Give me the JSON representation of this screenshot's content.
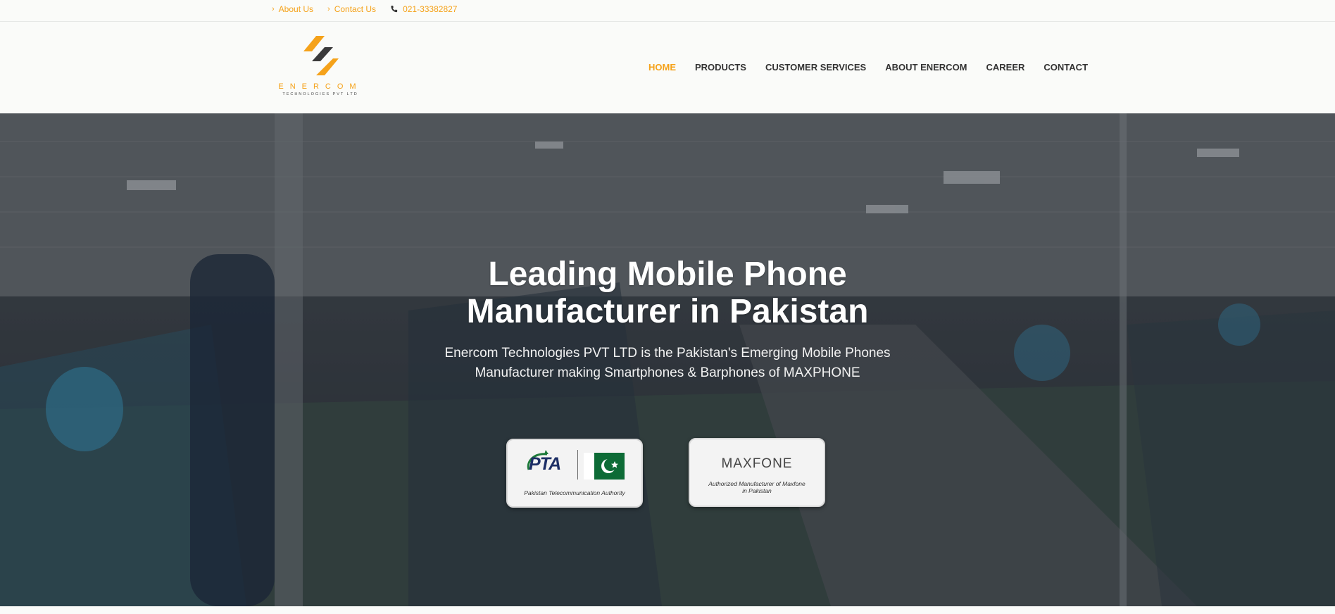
{
  "topbar": {
    "about_label": "About Us",
    "contact_label": "Contact Us",
    "phone": "021-33382827"
  },
  "brand": {
    "name": "ENERCOM",
    "tagline": "TECHNOLOGIES PVT LTD"
  },
  "nav": {
    "items": [
      {
        "label": "HOME",
        "active": true
      },
      {
        "label": "PRODUCTS"
      },
      {
        "label": "CUSTOMER SERVICES"
      },
      {
        "label": "ABOUT ENERCOM"
      },
      {
        "label": "CAREER"
      },
      {
        "label": "CONTACT"
      }
    ]
  },
  "hero": {
    "title_line1": "Leading Mobile Phone",
    "title_line2": "Manufacturer in Pakistan",
    "subtitle_line1": "Enercom Technologies PVT LTD is the Pakistan's Emerging Mobile Phones",
    "subtitle_line2": "Manufacturer making Smartphones & Barphones of MAXPHONE"
  },
  "badges": {
    "pta": {
      "logo_text": "PTA",
      "caption": "Pakistan Telecommunication Authority"
    },
    "maxfone": {
      "logo_text": "MAXFONE",
      "caption_line1": "Authorized Manufacturer of Maxfone",
      "caption_line2": "in Pakistan"
    }
  },
  "colors": {
    "accent": "#f5a21a",
    "nav_text": "#333333",
    "hero_text": "#ffffff"
  }
}
